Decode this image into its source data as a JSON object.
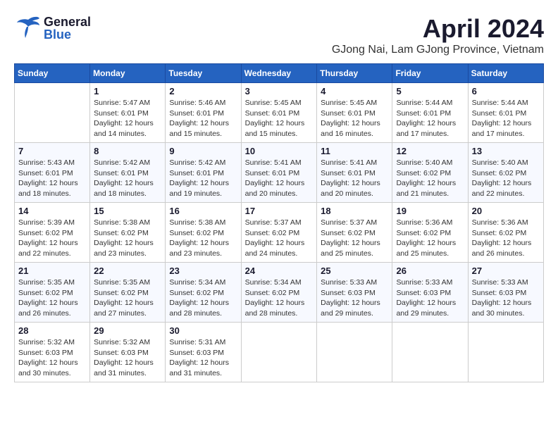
{
  "header": {
    "logo": {
      "general": "General",
      "blue": "Blue"
    },
    "title": "April 2024",
    "subtitle": "GJong Nai, Lam GJong Province, Vietnam"
  },
  "calendar": {
    "days_of_week": [
      "Sunday",
      "Monday",
      "Tuesday",
      "Wednesday",
      "Thursday",
      "Friday",
      "Saturday"
    ],
    "weeks": [
      [
        {
          "day": "",
          "info": ""
        },
        {
          "day": "1",
          "info": "Sunrise: 5:47 AM\nSunset: 6:01 PM\nDaylight: 12 hours\nand 14 minutes."
        },
        {
          "day": "2",
          "info": "Sunrise: 5:46 AM\nSunset: 6:01 PM\nDaylight: 12 hours\nand 15 minutes."
        },
        {
          "day": "3",
          "info": "Sunrise: 5:45 AM\nSunset: 6:01 PM\nDaylight: 12 hours\nand 15 minutes."
        },
        {
          "day": "4",
          "info": "Sunrise: 5:45 AM\nSunset: 6:01 PM\nDaylight: 12 hours\nand 16 minutes."
        },
        {
          "day": "5",
          "info": "Sunrise: 5:44 AM\nSunset: 6:01 PM\nDaylight: 12 hours\nand 17 minutes."
        },
        {
          "day": "6",
          "info": "Sunrise: 5:44 AM\nSunset: 6:01 PM\nDaylight: 12 hours\nand 17 minutes."
        }
      ],
      [
        {
          "day": "7",
          "info": "Sunrise: 5:43 AM\nSunset: 6:01 PM\nDaylight: 12 hours\nand 18 minutes."
        },
        {
          "day": "8",
          "info": "Sunrise: 5:42 AM\nSunset: 6:01 PM\nDaylight: 12 hours\nand 18 minutes."
        },
        {
          "day": "9",
          "info": "Sunrise: 5:42 AM\nSunset: 6:01 PM\nDaylight: 12 hours\nand 19 minutes."
        },
        {
          "day": "10",
          "info": "Sunrise: 5:41 AM\nSunset: 6:01 PM\nDaylight: 12 hours\nand 20 minutes."
        },
        {
          "day": "11",
          "info": "Sunrise: 5:41 AM\nSunset: 6:01 PM\nDaylight: 12 hours\nand 20 minutes."
        },
        {
          "day": "12",
          "info": "Sunrise: 5:40 AM\nSunset: 6:02 PM\nDaylight: 12 hours\nand 21 minutes."
        },
        {
          "day": "13",
          "info": "Sunrise: 5:40 AM\nSunset: 6:02 PM\nDaylight: 12 hours\nand 22 minutes."
        }
      ],
      [
        {
          "day": "14",
          "info": "Sunrise: 5:39 AM\nSunset: 6:02 PM\nDaylight: 12 hours\nand 22 minutes."
        },
        {
          "day": "15",
          "info": "Sunrise: 5:38 AM\nSunset: 6:02 PM\nDaylight: 12 hours\nand 23 minutes."
        },
        {
          "day": "16",
          "info": "Sunrise: 5:38 AM\nSunset: 6:02 PM\nDaylight: 12 hours\nand 23 minutes."
        },
        {
          "day": "17",
          "info": "Sunrise: 5:37 AM\nSunset: 6:02 PM\nDaylight: 12 hours\nand 24 minutes."
        },
        {
          "day": "18",
          "info": "Sunrise: 5:37 AM\nSunset: 6:02 PM\nDaylight: 12 hours\nand 25 minutes."
        },
        {
          "day": "19",
          "info": "Sunrise: 5:36 AM\nSunset: 6:02 PM\nDaylight: 12 hours\nand 25 minutes."
        },
        {
          "day": "20",
          "info": "Sunrise: 5:36 AM\nSunset: 6:02 PM\nDaylight: 12 hours\nand 26 minutes."
        }
      ],
      [
        {
          "day": "21",
          "info": "Sunrise: 5:35 AM\nSunset: 6:02 PM\nDaylight: 12 hours\nand 26 minutes."
        },
        {
          "day": "22",
          "info": "Sunrise: 5:35 AM\nSunset: 6:02 PM\nDaylight: 12 hours\nand 27 minutes."
        },
        {
          "day": "23",
          "info": "Sunrise: 5:34 AM\nSunset: 6:02 PM\nDaylight: 12 hours\nand 28 minutes."
        },
        {
          "day": "24",
          "info": "Sunrise: 5:34 AM\nSunset: 6:02 PM\nDaylight: 12 hours\nand 28 minutes."
        },
        {
          "day": "25",
          "info": "Sunrise: 5:33 AM\nSunset: 6:03 PM\nDaylight: 12 hours\nand 29 minutes."
        },
        {
          "day": "26",
          "info": "Sunrise: 5:33 AM\nSunset: 6:03 PM\nDaylight: 12 hours\nand 29 minutes."
        },
        {
          "day": "27",
          "info": "Sunrise: 5:33 AM\nSunset: 6:03 PM\nDaylight: 12 hours\nand 30 minutes."
        }
      ],
      [
        {
          "day": "28",
          "info": "Sunrise: 5:32 AM\nSunset: 6:03 PM\nDaylight: 12 hours\nand 30 minutes."
        },
        {
          "day": "29",
          "info": "Sunrise: 5:32 AM\nSunset: 6:03 PM\nDaylight: 12 hours\nand 31 minutes."
        },
        {
          "day": "30",
          "info": "Sunrise: 5:31 AM\nSunset: 6:03 PM\nDaylight: 12 hours\nand 31 minutes."
        },
        {
          "day": "",
          "info": ""
        },
        {
          "day": "",
          "info": ""
        },
        {
          "day": "",
          "info": ""
        },
        {
          "day": "",
          "info": ""
        }
      ]
    ]
  }
}
